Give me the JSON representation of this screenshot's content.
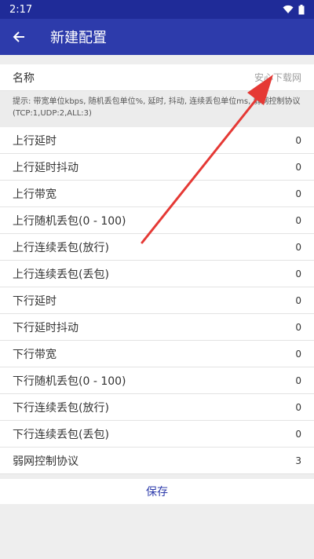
{
  "status_bar": {
    "time": "2:17"
  },
  "app_bar": {
    "title": "新建配置"
  },
  "name_row": {
    "label": "名称",
    "placeholder": "安心下载网"
  },
  "hint": "提示: 带宽单位kbps, 随机丢包单位%, 延时, 抖动, 连续丢包单位ms, 弱网控制协议(TCP:1,UDP:2,ALL:3)",
  "rows": [
    {
      "label": "上行延时",
      "value": "0"
    },
    {
      "label": "上行延时抖动",
      "value": "0"
    },
    {
      "label": "上行带宽",
      "value": "0"
    },
    {
      "label": "上行随机丢包(0 - 100)",
      "value": "0"
    },
    {
      "label": "上行连续丢包(放行)",
      "value": "0"
    },
    {
      "label": "上行连续丢包(丢包)",
      "value": "0"
    },
    {
      "label": "下行延时",
      "value": "0"
    },
    {
      "label": "下行延时抖动",
      "value": "0"
    },
    {
      "label": "下行带宽",
      "value": "0"
    },
    {
      "label": "下行随机丢包(0 - 100)",
      "value": "0"
    },
    {
      "label": "下行连续丢包(放行)",
      "value": "0"
    },
    {
      "label": "下行连续丢包(丢包)",
      "value": "0"
    },
    {
      "label": "弱网控制协议",
      "value": "3"
    }
  ],
  "save_label": "保存",
  "colors": {
    "app_bar": "#2d3bab",
    "status_bar": "#1f2b98",
    "annotation_arrow": "#e53935"
  }
}
